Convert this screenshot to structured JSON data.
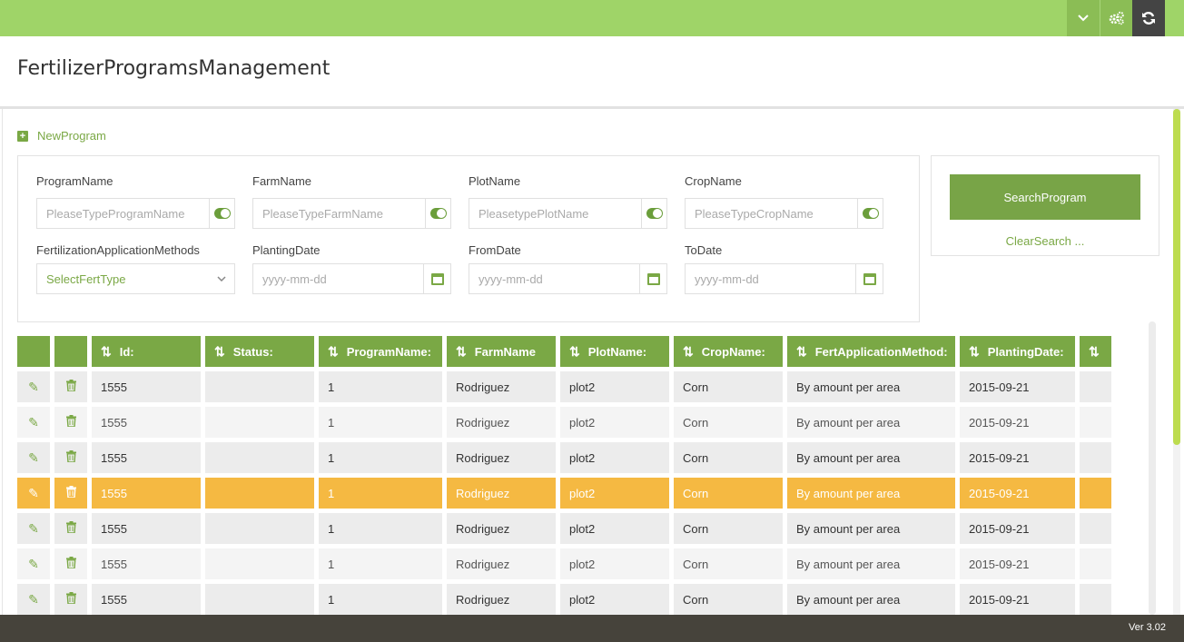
{
  "page_title": "FertilizerProgramsManagement",
  "new_program_label": "NewProgram",
  "filters": {
    "program_name": {
      "label": "ProgramName",
      "placeholder": "PleaseTypeProgramName"
    },
    "farm_name": {
      "label": "FarmName",
      "placeholder": "PleaseTypeFarmName"
    },
    "plot_name": {
      "label": "PlotName",
      "placeholder": "PleasetypePlotName"
    },
    "crop_name": {
      "label": "CropName",
      "placeholder": "PleaseTypeCropName"
    },
    "fert_methods": {
      "label": "FertilizationApplicationMethods",
      "value": "SelectFertType"
    },
    "planting_date": {
      "label": "PlantingDate",
      "placeholder": "yyyy-mm-dd"
    },
    "from_date": {
      "label": "FromDate",
      "placeholder": "yyyy-mm-dd"
    },
    "to_date": {
      "label": "ToDate",
      "placeholder": "yyyy-mm-dd"
    }
  },
  "search_button_label": "SearchProgram",
  "clear_search_label": "ClearSearch ...",
  "table": {
    "headers": [
      "Id:",
      "Status:",
      "ProgramName:",
      "FarmName",
      "PlotName:",
      "CropName:",
      "FertApplicationMethod:",
      "PlantingDate:"
    ],
    "rows": [
      {
        "id": "1555",
        "status": "",
        "program": "1",
        "farm": "Rodriguez",
        "plot": "plot2",
        "crop": "Corn",
        "method": "By amount per area",
        "date": "2015-09-21"
      },
      {
        "id": "1555",
        "status": "",
        "program": "1",
        "farm": "Rodriguez",
        "plot": "plot2",
        "crop": "Corn",
        "method": "By amount per area",
        "date": "2015-09-21"
      },
      {
        "id": "1555",
        "status": "",
        "program": "1",
        "farm": "Rodriguez",
        "plot": "plot2",
        "crop": "Corn",
        "method": "By amount per area",
        "date": "2015-09-21"
      },
      {
        "id": "1555",
        "status": "",
        "program": "1",
        "farm": "Rodriguez",
        "plot": "plot2",
        "crop": "Corn",
        "method": "By amount per area",
        "date": "2015-09-21"
      },
      {
        "id": "1555",
        "status": "",
        "program": "1",
        "farm": "Rodriguez",
        "plot": "plot2",
        "crop": "Corn",
        "method": "By amount per area",
        "date": "2015-09-21"
      },
      {
        "id": "1555",
        "status": "",
        "program": "1",
        "farm": "Rodriguez",
        "plot": "plot2",
        "crop": "Corn",
        "method": "By amount per area",
        "date": "2015-09-21"
      },
      {
        "id": "1555",
        "status": "",
        "program": "1",
        "farm": "Rodriguez",
        "plot": "plot2",
        "crop": "Corn",
        "method": "By amount per area",
        "date": "2015-09-21"
      }
    ],
    "selected_row_index": 3
  },
  "version": "Ver 3.02",
  "colors": {
    "topbar": "#9fd468",
    "accent": "#7aa845",
    "selected_row": "#f5b942",
    "footer": "#46433b"
  },
  "icons": {
    "topbar": [
      "chevron-down-icon",
      "gears-icon",
      "refresh-icon"
    ],
    "row": [
      "pencil-icon",
      "trash-icon"
    ]
  }
}
